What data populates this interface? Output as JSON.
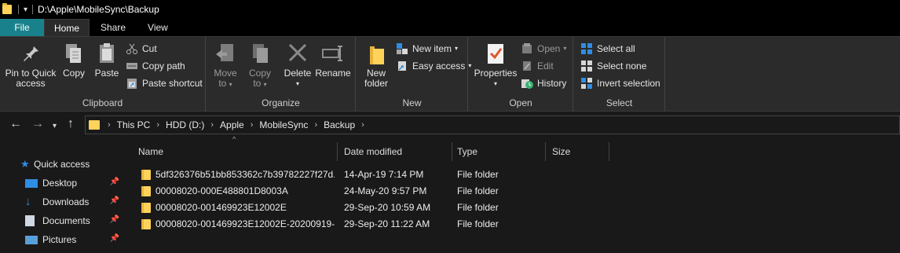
{
  "window": {
    "title": "D:\\Apple\\MobileSync\\Backup"
  },
  "tabs": [
    "File",
    "Home",
    "Share",
    "View"
  ],
  "ribbon": {
    "clipboard": {
      "label": "Clipboard",
      "pin_to_quick_access_line1": "Pin to Quick",
      "pin_to_quick_access_line2": "access",
      "copy": "Copy",
      "paste": "Paste",
      "cut": "Cut",
      "copy_path": "Copy path",
      "paste_shortcut": "Paste shortcut"
    },
    "organize": {
      "label": "Organize",
      "move_to_line1": "Move",
      "move_to_line2": "to",
      "copy_to_line1": "Copy",
      "copy_to_line2": "to",
      "delete": "Delete",
      "rename": "Rename"
    },
    "new": {
      "label": "New",
      "new_folder_line1": "New",
      "new_folder_line2": "folder",
      "new_item": "New item",
      "easy_access": "Easy access"
    },
    "open": {
      "label": "Open",
      "properties": "Properties",
      "open": "Open",
      "edit": "Edit",
      "history": "History"
    },
    "select": {
      "label": "Select",
      "select_all": "Select all",
      "select_none": "Select none",
      "invert_selection": "Invert selection"
    }
  },
  "address": {
    "crumbs": [
      "This PC",
      "HDD (D:)",
      "Apple",
      "MobileSync",
      "Backup"
    ]
  },
  "navpane": {
    "items": [
      {
        "label": "Quick access",
        "icon": "star-icon"
      },
      {
        "label": "Desktop",
        "icon": "desktop-icon"
      },
      {
        "label": "Downloads",
        "icon": "download-icon"
      },
      {
        "label": "Documents",
        "icon": "documents-icon"
      },
      {
        "label": "Pictures",
        "icon": "pictures-icon"
      }
    ]
  },
  "columns": {
    "name": "Name",
    "date_modified": "Date modified",
    "type": "Type",
    "size": "Size"
  },
  "files": [
    {
      "name": "5df326376b51bb853362c7b39782227f27d...",
      "date": "14-Apr-19 7:14 PM",
      "type": "File folder",
      "size": ""
    },
    {
      "name": "00008020-000E488801D8003A",
      "date": "24-May-20 9:57 PM",
      "type": "File folder",
      "size": ""
    },
    {
      "name": "00008020-001469923E12002E",
      "date": "29-Sep-20 10:59 AM",
      "type": "File folder",
      "size": ""
    },
    {
      "name": "00008020-001469923E12002E-20200919-1...",
      "date": "29-Sep-20 11:22 AM",
      "type": "File folder",
      "size": ""
    }
  ],
  "colors": {
    "file_tab": "#19818c",
    "folder": "#ffd35a",
    "accent": "#2f8de4"
  }
}
